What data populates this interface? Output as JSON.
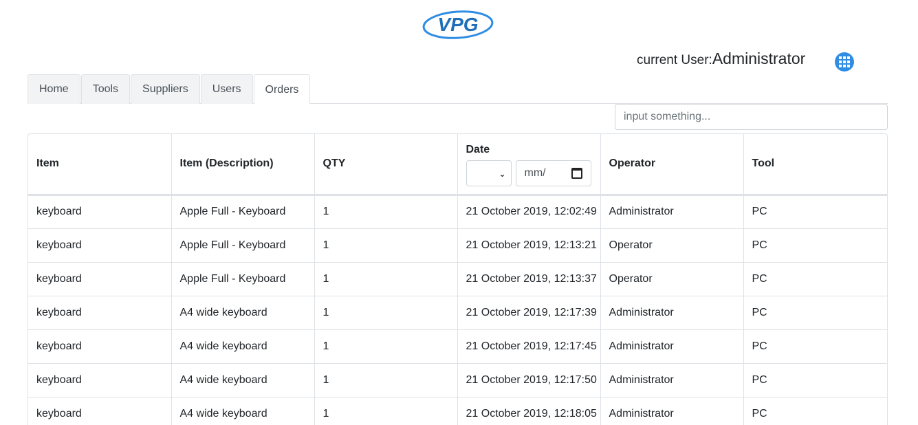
{
  "brand": {
    "logo_text": "VPG"
  },
  "user": {
    "prefix": "current User:",
    "name": "Administrator"
  },
  "tabs": [
    {
      "label": "Home",
      "active": false
    },
    {
      "label": "Tools",
      "active": false
    },
    {
      "label": "Suppliers",
      "active": false
    },
    {
      "label": "Users",
      "active": false
    },
    {
      "label": "Orders",
      "active": true
    }
  ],
  "search": {
    "placeholder": "input something...",
    "value": ""
  },
  "table": {
    "headers": {
      "item": "Item",
      "description": "Item (Description)",
      "qty": "QTY",
      "date": "Date",
      "operator": "Operator",
      "tool": "Tool"
    },
    "date_filter": {
      "select_value": "",
      "date_placeholder": "mm/"
    },
    "rows": [
      {
        "item": "keyboard",
        "description": "Apple Full - Keyboard",
        "qty": "1",
        "date": "21 October 2019, 12:02:49",
        "operator": "Administrator",
        "tool": "PC"
      },
      {
        "item": "keyboard",
        "description": "Apple Full - Keyboard",
        "qty": "1",
        "date": "21 October 2019, 12:13:21",
        "operator": "Operator",
        "tool": "PC"
      },
      {
        "item": "keyboard",
        "description": "Apple Full - Keyboard",
        "qty": "1",
        "date": "21 October 2019, 12:13:37",
        "operator": "Operator",
        "tool": "PC"
      },
      {
        "item": "keyboard",
        "description": "A4 wide keyboard",
        "qty": "1",
        "date": "21 October 2019, 12:17:39",
        "operator": "Administrator",
        "tool": "PC"
      },
      {
        "item": "keyboard",
        "description": "A4 wide keyboard",
        "qty": "1",
        "date": "21 October 2019, 12:17:45",
        "operator": "Administrator",
        "tool": "PC"
      },
      {
        "item": "keyboard",
        "description": "A4 wide keyboard",
        "qty": "1",
        "date": "21 October 2019, 12:17:50",
        "operator": "Administrator",
        "tool": "PC"
      },
      {
        "item": "keyboard",
        "description": "A4 wide keyboard",
        "qty": "1",
        "date": "21 October 2019, 12:18:05",
        "operator": "Administrator",
        "tool": "PC"
      }
    ]
  },
  "colors": {
    "accent": "#2f8de4",
    "logo_blue": "#1f6fb8",
    "border": "#dee2e6"
  },
  "icons": {
    "apps": "grid-apps-icon",
    "calendar": "calendar-icon",
    "select": "chevron-down-icon"
  }
}
